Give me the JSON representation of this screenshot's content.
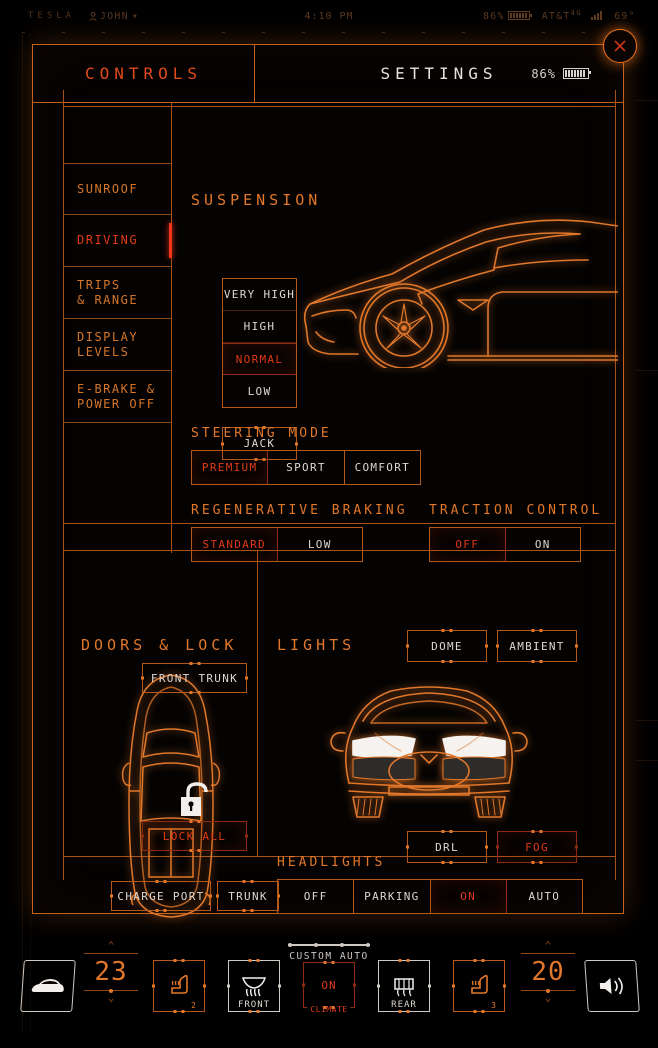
{
  "statusbar": {
    "brand": "TESLA",
    "user": "JOHN",
    "user_icon": "person-icon",
    "caret": "▾",
    "time": "4:10 PM",
    "battery_pct": "86%",
    "carrier": "AT&T",
    "network": "4G",
    "temperature": "69°"
  },
  "header": {
    "tab_controls": "CONTROLS",
    "tab_settings": "SETTINGS",
    "battery_pct": "86%",
    "close_icon": "close-icon"
  },
  "sidebar": {
    "items": [
      {
        "label": "SUNROOF",
        "active": false
      },
      {
        "label": "DRIVING",
        "active": true
      },
      {
        "label": "TRIPS\n& RANGE",
        "line1": "TRIPS",
        "line2": "& RANGE",
        "active": false
      },
      {
        "label": "DISPLAY\nLEVELS",
        "line1": "DISPLAY",
        "line2": "LEVELS",
        "active": false
      },
      {
        "label": "E-BRAKE &\nPOWER OFF",
        "line1": "E-BRAKE &",
        "line2": "POWER OFF",
        "active": false
      }
    ]
  },
  "suspension": {
    "title": "SUSPENSION",
    "options": [
      {
        "label": "VERY HIGH",
        "selected": false
      },
      {
        "label": "HIGH",
        "selected": false
      },
      {
        "label": "NORMAL",
        "selected": true
      },
      {
        "label": "LOW",
        "selected": false
      }
    ],
    "jack": "JACK",
    "car_illustration": "car-side-profile-icon"
  },
  "steering": {
    "title": "STEERING MODE",
    "options": [
      {
        "label": "PREMIUM",
        "selected": true
      },
      {
        "label": "SPORT",
        "selected": false
      },
      {
        "label": "COMFORT",
        "selected": false
      }
    ]
  },
  "regen": {
    "title": "REGENERATIVE BRAKING",
    "options": [
      {
        "label": "STANDARD",
        "selected": true
      },
      {
        "label": "LOW",
        "selected": false
      }
    ]
  },
  "traction": {
    "title": "TRACTION CONTROL",
    "options": [
      {
        "label": "OFF",
        "selected": true
      },
      {
        "label": "ON",
        "selected": false
      }
    ]
  },
  "doors": {
    "title": "DOORS & LOCK",
    "front_trunk": "FRONT TRUNK",
    "lock_all": "LOCK ALL",
    "charge_port": "CHARGE PORT",
    "trunk": "TRUNK",
    "lock_icon": "unlocked-padlock-icon",
    "car_illustration": "car-top-view-icon"
  },
  "lights": {
    "title": "LIGHTS",
    "dome": "DOME",
    "ambient": "AMBIENT",
    "drl": "DRL",
    "fog": "FOG",
    "fog_selected": true,
    "headlights_title": "HEADLIGHTS",
    "headlight_options": [
      {
        "label": "OFF",
        "selected": false
      },
      {
        "label": "PARKING",
        "selected": false
      },
      {
        "label": "ON",
        "selected": true
      },
      {
        "label": "AUTO",
        "selected": false
      }
    ],
    "car_illustration": "car-front-view-icon"
  },
  "climate": {
    "car_icon": "car-profile-icon",
    "left_temp": "23",
    "right_temp": "20",
    "left_seat_level": "2",
    "right_seat_level": "3",
    "seat_icon": "heated-seat-icon",
    "front_defrost_label": "FRONT",
    "rear_defrost_label": "REAR",
    "defrost_icon": "defrost-icon",
    "custom_auto": "CUSTOM AUTO",
    "climate_state": "ON",
    "climate_label": "CLIMATE",
    "volume_icon": "volume-icon",
    "chevron_up": "⌃",
    "chevron_down": "⌄"
  },
  "colors": {
    "accent_orange": "#e0772a",
    "accent_red": "#e03a18",
    "border_orange": "#b5591a",
    "text_light": "#ddd8d3",
    "background": "#000000"
  }
}
